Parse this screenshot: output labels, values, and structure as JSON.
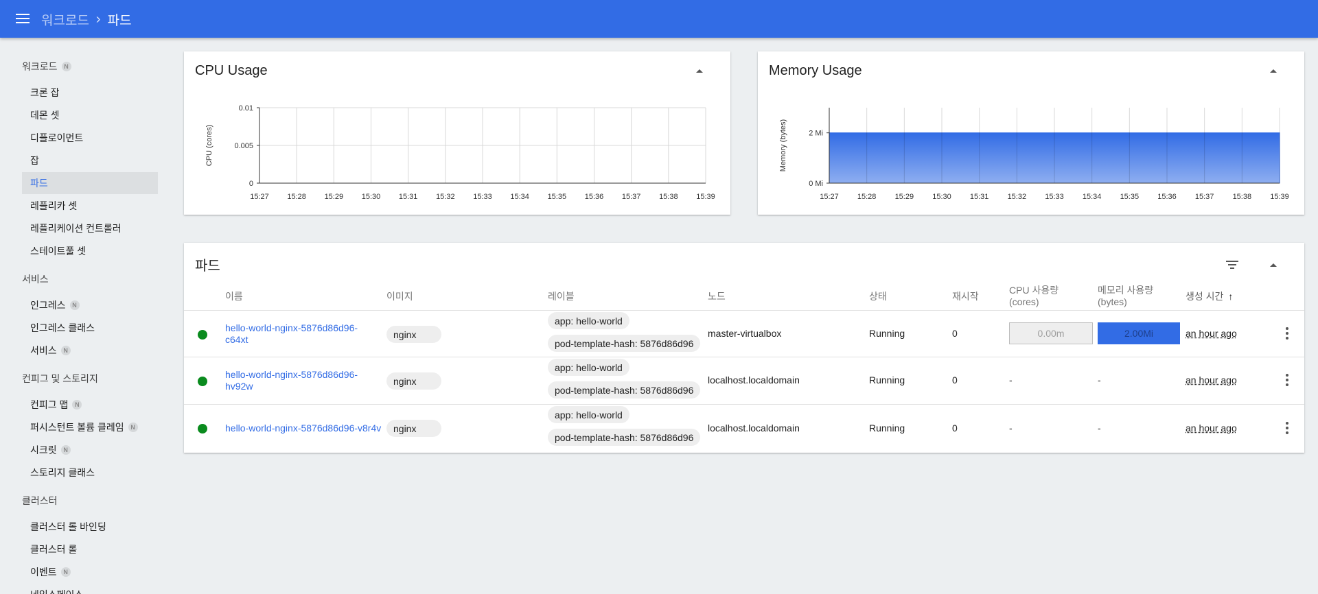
{
  "breadcrumb": {
    "parent": "워크로드",
    "current": "파드"
  },
  "sidebar": {
    "sections": [
      {
        "label": "워크로드",
        "badge": "N",
        "items": [
          {
            "label": "크론 잡",
            "badge": ""
          },
          {
            "label": "데몬 셋",
            "badge": ""
          },
          {
            "label": "디플로이먼트",
            "badge": ""
          },
          {
            "label": "잡",
            "badge": ""
          },
          {
            "label": "파드",
            "badge": "",
            "active": true
          },
          {
            "label": "레플리카 셋",
            "badge": ""
          },
          {
            "label": "레플리케이션 컨트롤러",
            "badge": ""
          },
          {
            "label": "스테이트풀 셋",
            "badge": ""
          }
        ]
      },
      {
        "label": "서비스",
        "badge": "",
        "items": [
          {
            "label": "인그레스",
            "badge": "N"
          },
          {
            "label": "인그레스 클래스",
            "badge": ""
          },
          {
            "label": "서비스",
            "badge": "N"
          }
        ]
      },
      {
        "label": "컨피그 및 스토리지",
        "badge": "",
        "items": [
          {
            "label": "컨피그 맵",
            "badge": "N"
          },
          {
            "label": "퍼시스턴트 볼륨 클레임",
            "badge": "N"
          },
          {
            "label": "시크릿",
            "badge": "N"
          },
          {
            "label": "스토리지 클래스",
            "badge": ""
          }
        ]
      },
      {
        "label": "클러스터",
        "badge": "",
        "items": [
          {
            "label": "클러스터 롤 바인딩",
            "badge": ""
          },
          {
            "label": "클러스터 롤",
            "badge": ""
          },
          {
            "label": "이벤트",
            "badge": "N"
          },
          {
            "label": "네임스페이스",
            "badge": ""
          }
        ]
      }
    ]
  },
  "cpu_card": {
    "title": "CPU Usage"
  },
  "memory_card": {
    "title": "Memory Usage"
  },
  "chart_data": [
    {
      "type": "line",
      "ylabel": "CPU (cores)",
      "x": [
        "15:27",
        "15:28",
        "15:29",
        "15:30",
        "15:31",
        "15:32",
        "15:33",
        "15:34",
        "15:35",
        "15:36",
        "15:37",
        "15:38",
        "15:39"
      ],
      "y_ticks": [
        "0",
        "0.005",
        "0.01"
      ],
      "ylim": [
        0,
        0.01
      ],
      "series": [
        {
          "values": []
        }
      ],
      "grid": true
    },
    {
      "type": "area",
      "ylabel": "Memory (bytes)",
      "x": [
        "15:27",
        "15:28",
        "15:29",
        "15:30",
        "15:31",
        "15:32",
        "15:33",
        "15:34",
        "15:35",
        "15:36",
        "15:37",
        "15:38",
        "15:39"
      ],
      "y_ticks": [
        "0 Mi",
        "2 Mi"
      ],
      "ylim": [
        0,
        3
      ],
      "series": [
        {
          "values": [
            2,
            2,
            2,
            2,
            2,
            2,
            2,
            2,
            2,
            2,
            2,
            2,
            2
          ]
        }
      ],
      "grid": true,
      "color": "#326ce5"
    }
  ],
  "pods": {
    "title": "파드",
    "columns": {
      "name": "이름",
      "image": "이미지",
      "labels": "레이블",
      "node": "노드",
      "status": "상태",
      "restarts": "재시작",
      "cpu_1": "CPU 사용량",
      "cpu_2": "(cores)",
      "mem_1": "메모리 사용량",
      "mem_2": "(bytes)",
      "created": "생성 시간",
      "sort_icon": "↑"
    },
    "rows": [
      {
        "name_1": "hello-world-nginx-5876d86d96-",
        "name_2": "c64xt",
        "image": "nginx",
        "label_1": "app: hello-world",
        "label_2": "pod-template-hash: 5876d86d96",
        "node": "master-virtualbox",
        "status": "Running",
        "restarts": "0",
        "cpu": "0.00m",
        "mem": "2.00Mi",
        "created": "an hour ago",
        "status_color": "#0a8b1e"
      },
      {
        "name_1": "hello-world-nginx-5876d86d96-",
        "name_2": "hv92w",
        "image": "nginx",
        "label_1": "app: hello-world",
        "label_2": "pod-template-hash: 5876d86d96",
        "node": "localhost.localdomain",
        "status": "Running",
        "restarts": "0",
        "cpu": "-",
        "mem": "-",
        "created": "an hour ago",
        "status_color": "#0a8b1e"
      },
      {
        "name_1": "hello-world-nginx-5876d86d96-v8r4v",
        "name_2": "",
        "image": "nginx",
        "label_1": "app: hello-world",
        "label_2": "pod-template-hash: 5876d86d96",
        "node": "localhost.localdomain",
        "status": "Running",
        "restarts": "0",
        "cpu": "-",
        "mem": "-",
        "created": "an hour ago",
        "status_color": "#0a8b1e"
      }
    ]
  }
}
